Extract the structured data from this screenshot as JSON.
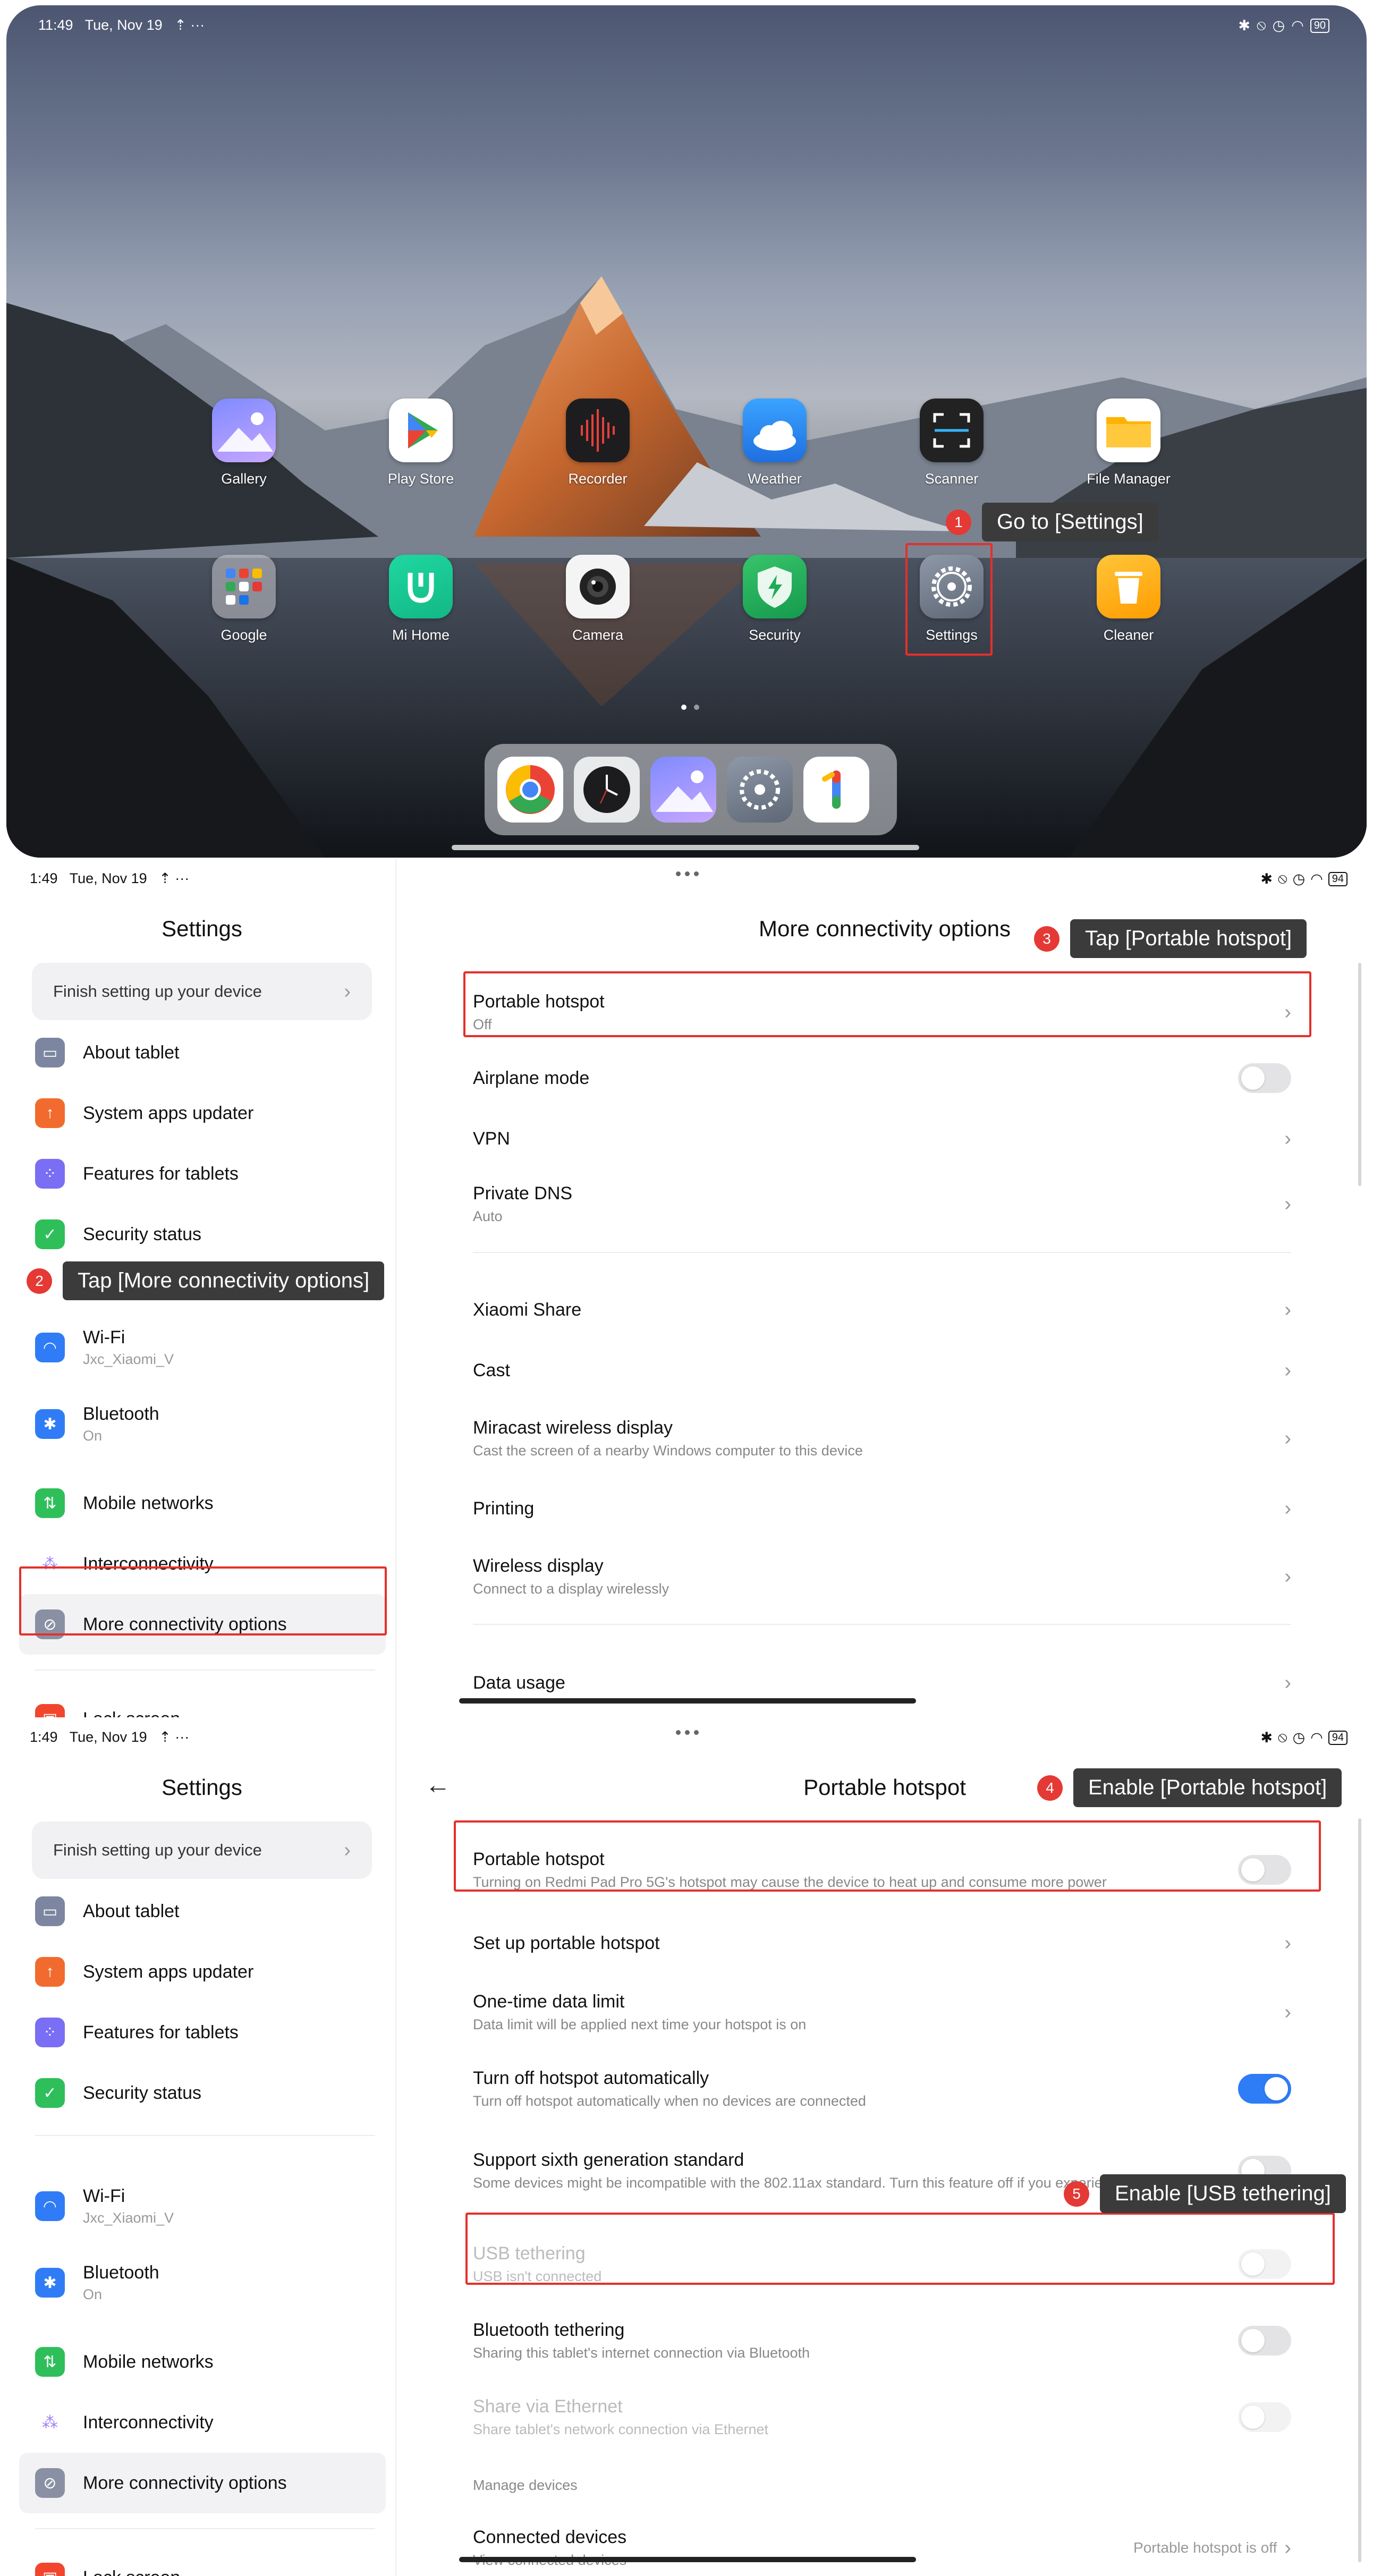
{
  "home": {
    "status_time": "11:49",
    "status_date": "Tue, Nov 19",
    "status_extra": "⇡ ···",
    "battery": "90",
    "apps_row1": [
      "Gallery",
      "Play Store",
      "Recorder",
      "Weather",
      "Scanner",
      "File Manager"
    ],
    "apps_row2": [
      "Google",
      "Mi Home",
      "Camera",
      "Security",
      "Settings",
      "Cleaner"
    ],
    "step1": {
      "num": "1",
      "text": "Go to [Settings]"
    }
  },
  "settings": {
    "status_time": "1:49",
    "status_date": "Tue, Nov 19",
    "status_extra": "⇡ ···",
    "battery": "94",
    "title": "Settings",
    "finish_setup": "Finish setting up your device",
    "items": {
      "about": "About tablet",
      "updater": "System apps updater",
      "features": "Features for tablets",
      "security": "Security status",
      "wifi": "Wi-Fi",
      "wifi_sub": "Jxc_Xiaomi_V",
      "bluetooth": "Bluetooth",
      "bluetooth_sub": "On",
      "mobile": "Mobile networks",
      "interconnect": "Interconnectivity",
      "more_conn": "More connectivity options",
      "lock": "Lock screen"
    }
  },
  "more_conn": {
    "title": "More connectivity options",
    "hotspot": "Portable hotspot",
    "hotspot_sub": "Off",
    "airplane": "Airplane mode",
    "vpn": "VPN",
    "dns": "Private DNS",
    "dns_sub": "Auto",
    "share": "Xiaomi Share",
    "cast": "Cast",
    "miracast": "Miracast wireless display",
    "miracast_sub": "Cast the screen of a nearby Windows computer to this device",
    "printing": "Printing",
    "wireless": "Wireless display",
    "wireless_sub": "Connect to a display wirelessly",
    "data_usage": "Data usage",
    "step2": {
      "num": "2",
      "text": "Tap [More connectivity options]"
    },
    "step3": {
      "num": "3",
      "text": "Tap [Portable hotspot]"
    }
  },
  "hotspot": {
    "title": "Portable hotspot",
    "hotspot": "Portable hotspot",
    "hotspot_sub": "Turning on Redmi Pad Pro 5G's hotspot may cause the device to heat up and consume more power",
    "setup": "Set up portable hotspot",
    "limit": "One-time data limit",
    "limit_sub": "Data limit will be applied next time your hotspot is on",
    "auto_off": "Turn off hotspot automatically",
    "auto_off_sub": "Turn off hotspot automatically when no devices are connected",
    "sixth": "Support sixth generation standard",
    "sixth_sub": "Some devices might be incompatible with the 802.11ax standard. Turn this feature off if you experience problems.",
    "usb": "USB tethering",
    "usb_sub": "USB isn't connected",
    "bt": "Bluetooth tethering",
    "bt_sub": "Sharing this tablet's internet connection via Bluetooth",
    "eth": "Share via Ethernet",
    "eth_sub": "Share tablet's network connection via Ethernet",
    "manage": "Manage devices",
    "connected": "Connected devices",
    "connected_sub": "View connected devices",
    "connected_value": "Portable hotspot is off",
    "step4": {
      "num": "4",
      "text": "Enable [Portable hotspot]"
    },
    "step5": {
      "num": "5",
      "text": "Enable [USB tethering]"
    }
  }
}
